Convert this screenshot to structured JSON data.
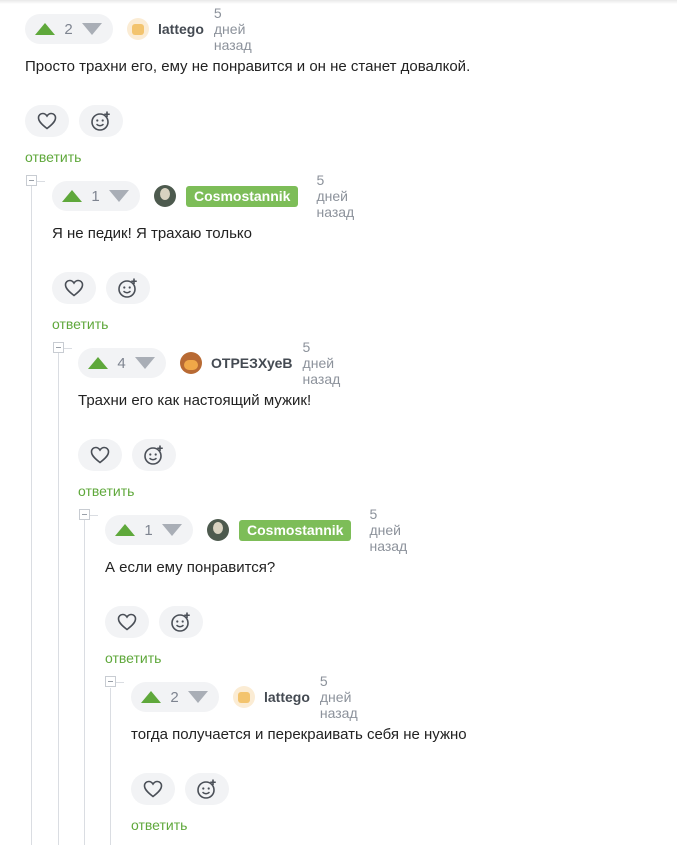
{
  "comments": [
    {
      "score": "2",
      "user": "lattego",
      "time": "5 дней назад",
      "text": "Просто трахни его, ему не понравится и он не станет довалкой.",
      "reply": "ответить"
    },
    {
      "score": "1",
      "user": "Cosmostannik",
      "time": "5 дней назад",
      "text": "Я не педик! Я трахаю только",
      "reply": "ответить"
    },
    {
      "score": "4",
      "user": "ОТРЕЗХуеВ",
      "time": "5 дней назад",
      "text": "Трахни его как настоящий мужик!",
      "reply": "ответить"
    },
    {
      "score": "1",
      "user": "Cosmostannik",
      "time": "5 дней назад",
      "text": "А если ему понравится?",
      "reply": "ответить"
    },
    {
      "score": "2",
      "user": "lattego",
      "time": "5 дней назад",
      "text": "тогда получается и перекраивать себя не нужно",
      "reply": "ответить"
    }
  ],
  "colors": {
    "accent": "#5fa83b",
    "badge": "#7dbd58",
    "downvote": "#a9aeb6",
    "pill_bg": "#f2f3f5"
  },
  "icons": {
    "upvote": "triangle-up-icon",
    "downvote": "triangle-down-icon",
    "like": "heart-icon",
    "react": "smiley-plus-icon",
    "collapse": "minus-square-icon"
  }
}
